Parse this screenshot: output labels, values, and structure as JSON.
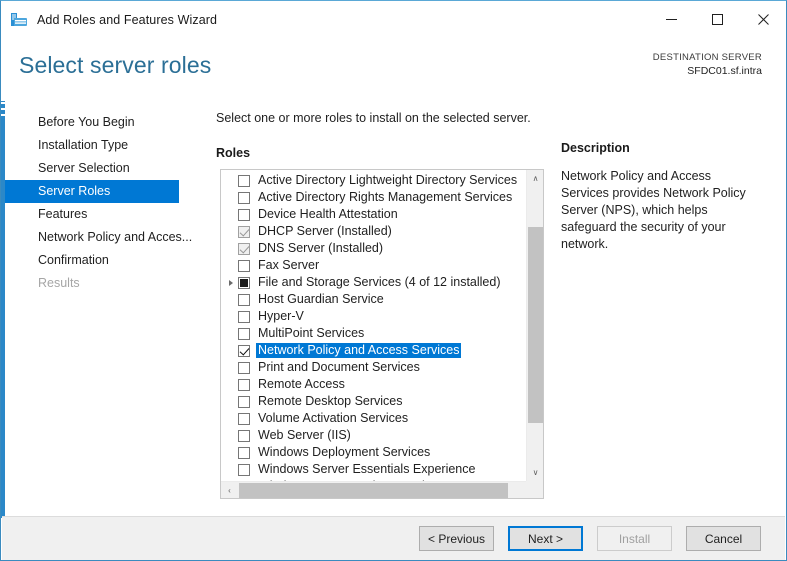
{
  "window": {
    "title": "Add Roles and Features Wizard",
    "icon": "server-manager-icon",
    "minimize_label": "–",
    "maximize_label": "☐",
    "close_label": "✕"
  },
  "header": {
    "page_title": "Select server roles",
    "destination_label": "DESTINATION SERVER",
    "destination_server": "SFDC01.sf.intra"
  },
  "nav": {
    "items": [
      {
        "label": "Before You Begin",
        "state": "normal"
      },
      {
        "label": "Installation Type",
        "state": "normal"
      },
      {
        "label": "Server Selection",
        "state": "normal"
      },
      {
        "label": "Server Roles",
        "state": "selected"
      },
      {
        "label": "Features",
        "state": "normal"
      },
      {
        "label": "Network Policy and Acces...",
        "state": "normal"
      },
      {
        "label": "Confirmation",
        "state": "normal"
      },
      {
        "label": "Results",
        "state": "disabled"
      }
    ]
  },
  "content": {
    "intro": "Select one or more roles to install on the selected server.",
    "roles_label": "Roles",
    "roles": [
      {
        "label": "Active Directory Lightweight Directory Services",
        "check": "unchecked",
        "expander": false,
        "selected": false
      },
      {
        "label": "Active Directory Rights Management Services",
        "check": "unchecked",
        "expander": false,
        "selected": false
      },
      {
        "label": "Device Health Attestation",
        "check": "unchecked",
        "expander": false,
        "selected": false
      },
      {
        "label": "DHCP Server (Installed)",
        "check": "installed",
        "expander": false,
        "selected": false
      },
      {
        "label": "DNS Server (Installed)",
        "check": "installed",
        "expander": false,
        "selected": false
      },
      {
        "label": "Fax Server",
        "check": "unchecked",
        "expander": false,
        "selected": false
      },
      {
        "label": "File and Storage Services (4 of 12 installed)",
        "check": "partial",
        "expander": true,
        "selected": false
      },
      {
        "label": "Host Guardian Service",
        "check": "unchecked",
        "expander": false,
        "selected": false
      },
      {
        "label": "Hyper-V",
        "check": "unchecked",
        "expander": false,
        "selected": false
      },
      {
        "label": "MultiPoint Services",
        "check": "unchecked",
        "expander": false,
        "selected": false
      },
      {
        "label": "Network Policy and Access Services",
        "check": "checked",
        "expander": false,
        "selected": true
      },
      {
        "label": "Print and Document Services",
        "check": "unchecked",
        "expander": false,
        "selected": false
      },
      {
        "label": "Remote Access",
        "check": "unchecked",
        "expander": false,
        "selected": false
      },
      {
        "label": "Remote Desktop Services",
        "check": "unchecked",
        "expander": false,
        "selected": false
      },
      {
        "label": "Volume Activation Services",
        "check": "unchecked",
        "expander": false,
        "selected": false
      },
      {
        "label": "Web Server (IIS)",
        "check": "unchecked",
        "expander": false,
        "selected": false
      },
      {
        "label": "Windows Deployment Services",
        "check": "unchecked",
        "expander": false,
        "selected": false
      },
      {
        "label": "Windows Server Essentials Experience",
        "check": "unchecked",
        "expander": false,
        "selected": false
      },
      {
        "label": "Windows Server Update Services",
        "check": "unchecked",
        "expander": false,
        "selected": false
      }
    ],
    "scrollbars": {
      "up_arrow": "∧",
      "down_arrow": "∨",
      "left_arrow": "‹",
      "right_arrow": "›"
    }
  },
  "description": {
    "title": "Description",
    "body": "Network Policy and Access Services provides Network Policy Server (NPS), which helps safeguard the security of your network."
  },
  "footer": {
    "previous_label": "< Previous",
    "next_label": "Next >",
    "install_label": "Install",
    "cancel_label": "Cancel"
  },
  "colors": {
    "accent": "#0078d4",
    "title_blue": "#2b6f96",
    "stripe": "#2b88c8"
  }
}
